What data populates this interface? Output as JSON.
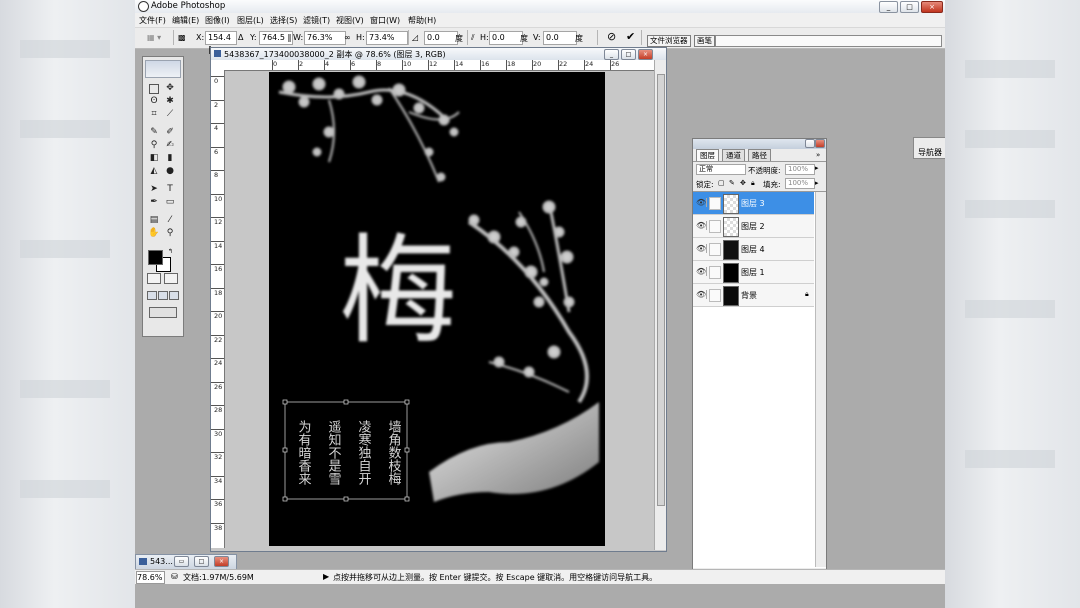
{
  "app": {
    "title": "Adobe Photoshop",
    "window_buttons": [
      "_",
      "□",
      "×"
    ]
  },
  "menu": [
    "文件(F)",
    "编辑(E)",
    "图像(I)",
    "图层(L)",
    "选择(S)",
    "滤镜(T)",
    "视图(V)",
    "窗口(W)",
    "帮助(H)"
  ],
  "options_bar": {
    "x_label": "X:",
    "x_value": "154.4 ‖",
    "y_label": "Y:",
    "y_value": "764.5 ‖",
    "w_label": "W:",
    "w_value": "76.3%",
    "h_label": "H:",
    "h_value": "73.4%",
    "rot_value": "0.0",
    "rot_unit": "度",
    "hskew_label": "H:",
    "hskew_value": "0.0",
    "hskew_unit": "度",
    "vskew_label": "V:",
    "vskew_value": "0.0",
    "vskew_unit": "度",
    "tab_file_browser": "文件浏览器",
    "tab_brush": "画笔"
  },
  "document": {
    "title": "5438367_173400038000_2 副本 @ 78.6% (图层 3, RGB)",
    "ruler_h": [
      "0",
      "2",
      "4",
      "6",
      "8",
      "10",
      "12",
      "14",
      "16",
      "18",
      "20",
      "22",
      "24",
      "26"
    ],
    "ruler_v": [
      "0",
      "2",
      "4",
      "6",
      "8",
      "10",
      "12",
      "14",
      "16",
      "18",
      "20",
      "22",
      "24",
      "26",
      "28",
      "30",
      "32",
      "34",
      "36",
      "38"
    ],
    "calligraphy_char": "梅",
    "poem_columns": [
      "墙角数枝梅",
      "凌寒独自开",
      "遥知不是雪",
      "为有暗香来"
    ]
  },
  "layers_panel": {
    "tabs": [
      "图层",
      "通道",
      "路径"
    ],
    "blend_mode": "正常",
    "opacity_label": "不透明度:",
    "opacity_value": "100%",
    "lock_label": "锁定:",
    "fill_label": "填充:",
    "fill_value": "100%",
    "layers": [
      {
        "name": "图层 3",
        "selected": true
      },
      {
        "name": "图层 2",
        "selected": false
      },
      {
        "name": "图层 4",
        "selected": false
      },
      {
        "name": "图层 1",
        "selected": false
      },
      {
        "name": "背景",
        "selected": false
      }
    ]
  },
  "navigator_tab": "导航器",
  "status": {
    "zoom": "78.6%",
    "doc_size": "文档:1.97M/5.69M",
    "hint": "点按并拖移可从边上测量。按 Enter 键提交。按 Escape 键取消。用空格键访问导航工具。"
  },
  "minimized_doc": "543...",
  "colors": {
    "selection": "#3d8fe6",
    "canvas": "#000000",
    "workspace": "#ababab"
  }
}
